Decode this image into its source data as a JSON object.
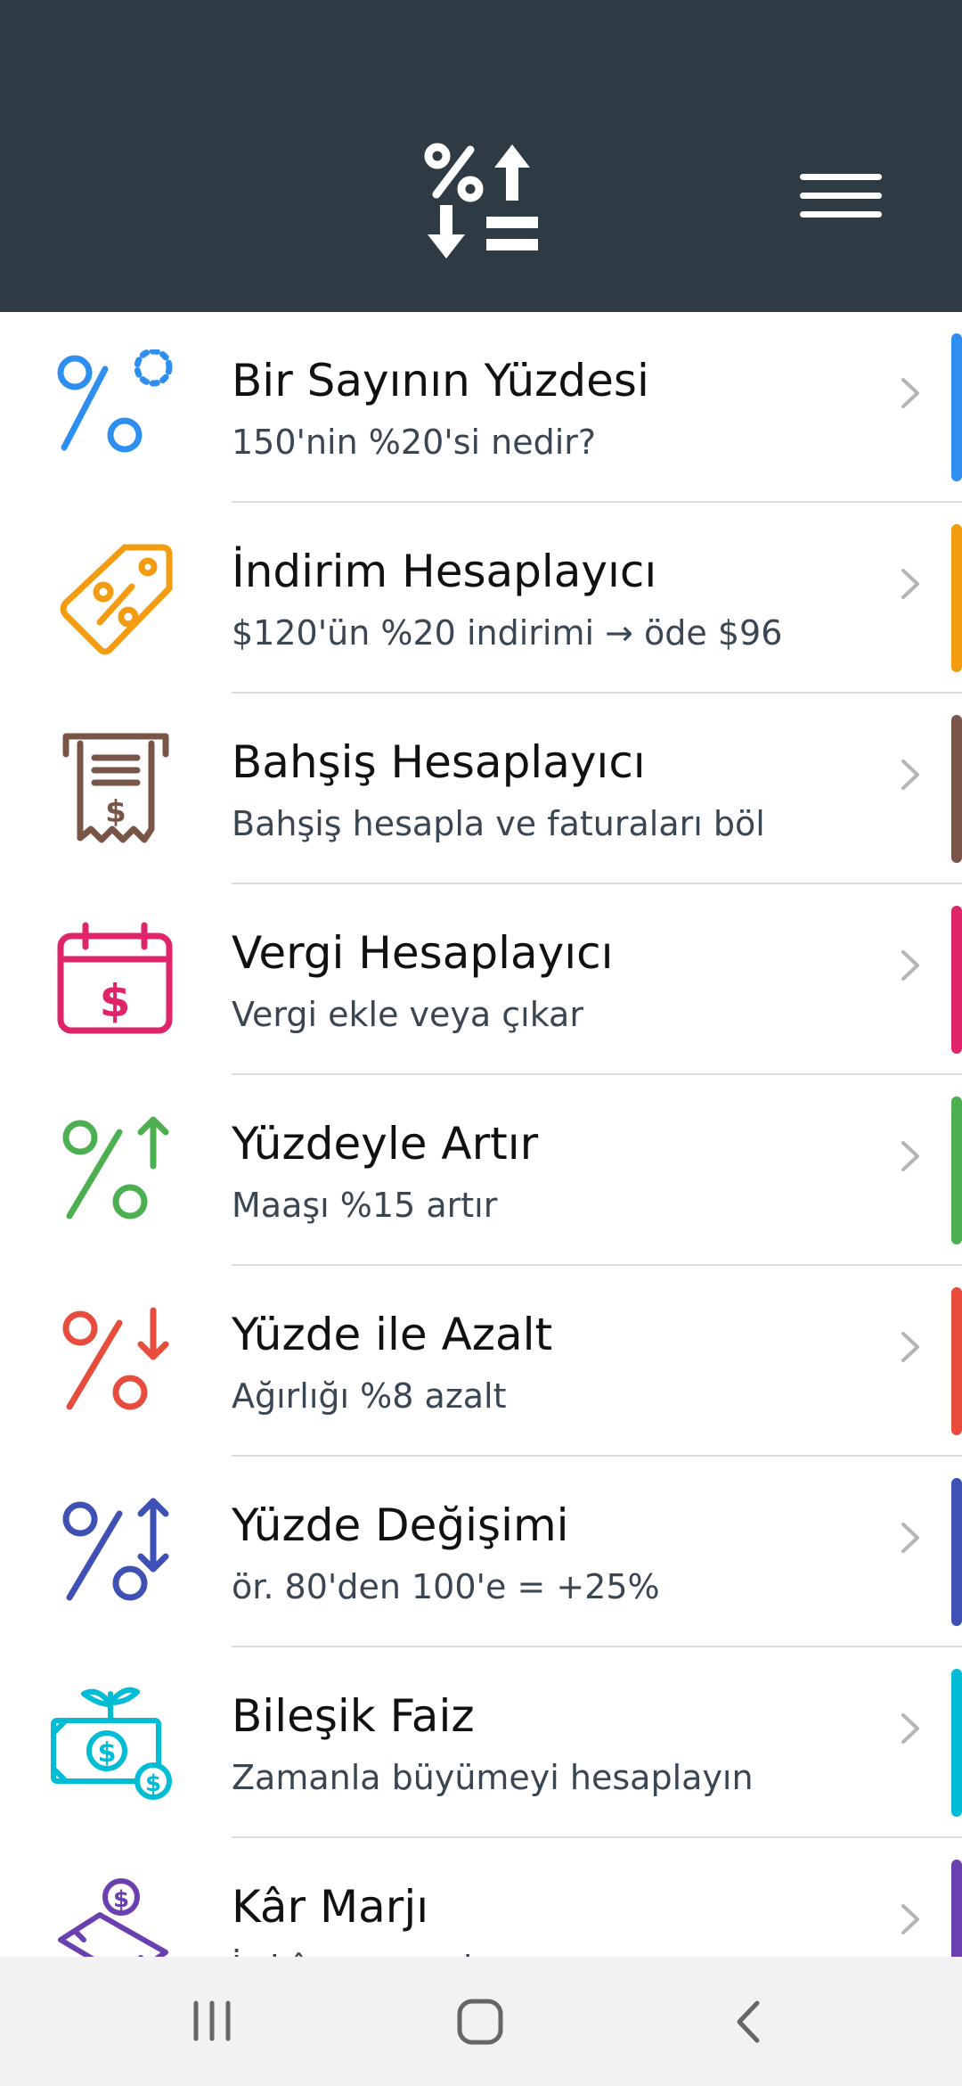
{
  "header": {
    "logo_icon": "percent-calculator-logo-icon",
    "menu_icon": "hamburger-menu-icon",
    "background": "#2e3a44"
  },
  "items": [
    {
      "title": "Bir Sayının Yüzdesi",
      "subtitle": "150'nin %20'si nedir?",
      "icon": "percent-icon",
      "color": "#2e8ff0"
    },
    {
      "title": "İndirim Hesaplayıcı",
      "subtitle": "$120'ün %20 indirimi → öde $96",
      "icon": "discount-tag-icon",
      "color": "#f39c12"
    },
    {
      "title": "Bahşiş Hesaplayıcı",
      "subtitle": "Bahşiş hesapla ve faturaları böl",
      "icon": "receipt-icon",
      "color": "#795548"
    },
    {
      "title": "Vergi Hesaplayıcı",
      "subtitle": "Vergi ekle veya çıkar",
      "icon": "tax-calendar-icon",
      "color": "#e0246a"
    },
    {
      "title": "Yüzdeyle Artır",
      "subtitle": "Maaşı %15 artır",
      "icon": "percent-increase-icon",
      "color": "#4caf50"
    },
    {
      "title": "Yüzde ile Azalt",
      "subtitle": "Ağırlığı %8 azalt",
      "icon": "percent-decrease-icon",
      "color": "#e74c3c"
    },
    {
      "title": "Yüzde Değişimi",
      "subtitle": "ör. 80'den 100'e = +25%",
      "icon": "percent-change-icon",
      "color": "#3f51b5"
    },
    {
      "title": "Bileşik Faiz",
      "subtitle": "Zamanla büyümeyi hesaplayın",
      "icon": "money-growth-icon",
      "color": "#00bcd4"
    },
    {
      "title": "Kâr Marjı",
      "subtitle": "İş kârı ve marjı",
      "icon": "profit-money-icon",
      "color": "#6a3fb0"
    }
  ],
  "navbar": {
    "recents_icon": "recent-apps-icon",
    "home_icon": "home-icon",
    "back_icon": "back-icon"
  }
}
